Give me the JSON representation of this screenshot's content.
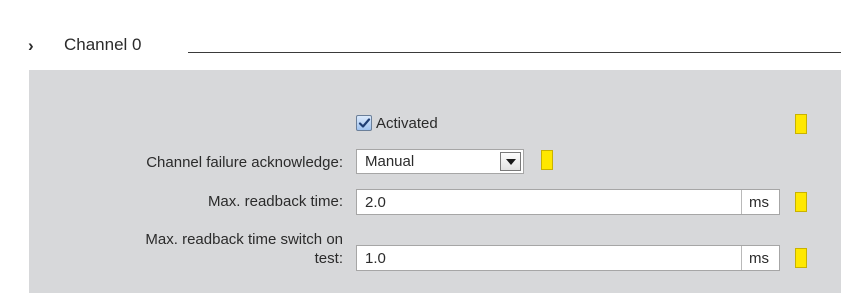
{
  "section": {
    "chevron": "›",
    "title": "Channel 0"
  },
  "activated": {
    "label": "Activated",
    "checked": true
  },
  "channel_failure": {
    "label": "Channel failure acknowledge:",
    "value": "Manual"
  },
  "max_readback": {
    "label": "Max. readback time:",
    "value": "2.0",
    "unit": "ms"
  },
  "max_readback_switch": {
    "label_line1": "Max. readback time switch on",
    "label_line2": "test:",
    "value": "1.0",
    "unit": "ms"
  },
  "icons": {
    "dropdown": "triangle-down",
    "check": "checkmark",
    "indicator": "yellow-flag"
  },
  "colors": {
    "panel_bg": "#d7d8da",
    "indicator": "#ffe800",
    "checkbox_fill": "#9fc2ef"
  }
}
